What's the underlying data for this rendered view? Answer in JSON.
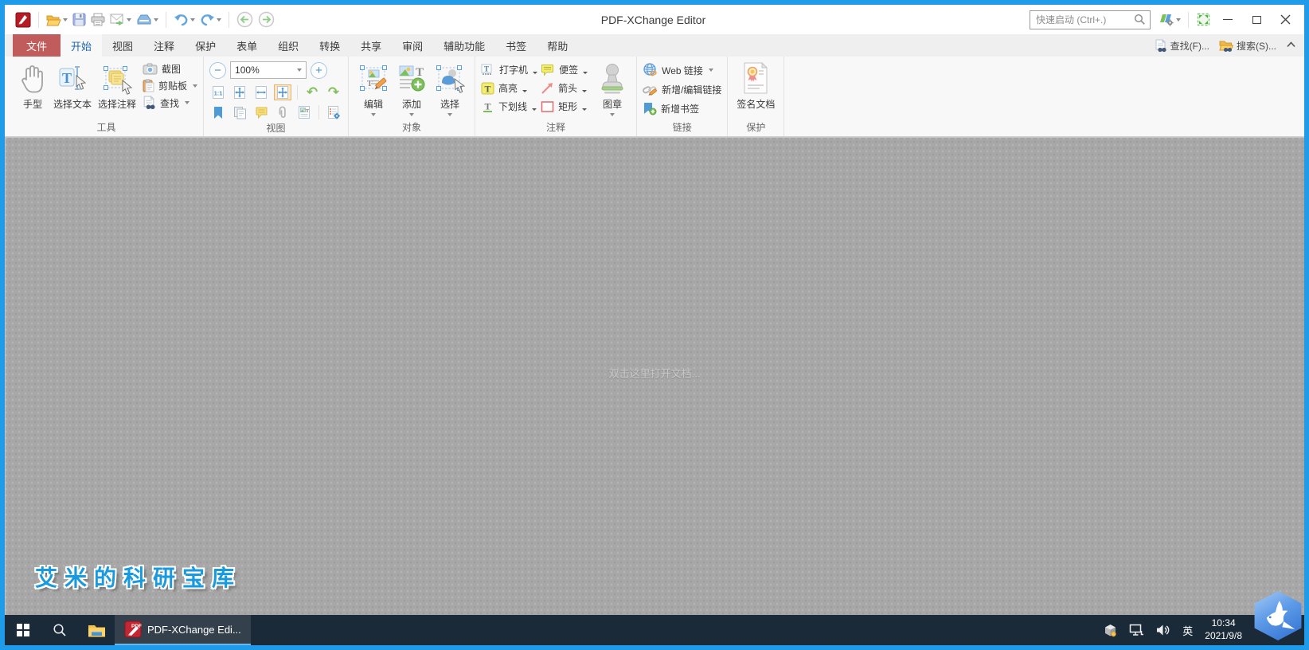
{
  "window": {
    "title": "PDF-XChange Editor"
  },
  "titlebar": {
    "quick_launch_placeholder": "快速启动 (Ctrl+.)"
  },
  "tabs": {
    "file": "文件",
    "items": [
      "开始",
      "视图",
      "注释",
      "保护",
      "表单",
      "组织",
      "转换",
      "共享",
      "审阅",
      "辅助功能",
      "书签",
      "帮助"
    ]
  },
  "tab_actions": {
    "find": "查找(F)...",
    "search": "搜索(S)..."
  },
  "ribbon": {
    "tools": {
      "label": "工具",
      "hand": "手型",
      "select_text": "选择文本",
      "select_comments": "选择注释",
      "snapshot": "截图",
      "clipboard": "剪贴板",
      "find": "查找"
    },
    "view": {
      "label": "视图",
      "zoom_value": "100%",
      "zoom_out": "−",
      "zoom_in": "+"
    },
    "object": {
      "label": "对象",
      "edit": "编辑",
      "add": "添加",
      "select": "选择"
    },
    "comment": {
      "label": "注释",
      "typewriter": "打字机",
      "note": "便签",
      "highlight": "高亮",
      "arrow": "箭头",
      "underline": "下划线",
      "rectangle": "矩形",
      "stamp": "图章"
    },
    "links": {
      "label": "链接",
      "web_link": "Web 链接",
      "add_edit_link": "新增/编辑链接",
      "add_bookmark": "新增书签"
    },
    "protect": {
      "label": "保护",
      "sign_doc": "签名文档"
    }
  },
  "canvas": {
    "hint": "双击这里打开文档...",
    "watermark": "艾米的科研宝库"
  },
  "taskbar": {
    "task": "PDF-XChange Edi...",
    "input_method": "英",
    "time": "10:34",
    "date": "2021/9/8"
  },
  "colors": {
    "frame_blue": "#1f9ce9",
    "file_tab_red": "#c05c5c",
    "active_tab_text": "#1e66ad",
    "taskbar_bg": "#1b2a38",
    "watermark_blue": "#1a9ade",
    "task_underline": "#6cb8ee"
  }
}
